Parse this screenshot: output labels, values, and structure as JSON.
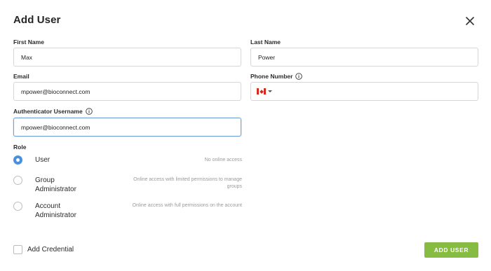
{
  "dialog": {
    "title": "Add User",
    "close_icon": "close-icon"
  },
  "form": {
    "first_name": {
      "label": "First Name",
      "value": "Max"
    },
    "last_name": {
      "label": "Last Name",
      "value": "Power"
    },
    "email": {
      "label": "Email",
      "value": "mpower@bioconnect.com"
    },
    "phone": {
      "label": "Phone Number",
      "info_icon": "info-icon",
      "country": "CA",
      "country_flag_icon": "canada-flag-icon",
      "value": ""
    },
    "auth_username": {
      "label": "Authenticator Username",
      "info_icon": "info-icon",
      "value": "mpower@bioconnect.com"
    }
  },
  "role": {
    "label": "Role",
    "selected": "User",
    "options": [
      {
        "title": "User",
        "description": "No online access",
        "checked": true
      },
      {
        "title": "Group Administrator",
        "title_lines": [
          "Group",
          "Administrator"
        ],
        "description_lines": [
          "Online access with limited permissions to manage",
          "groups"
        ],
        "checked": false
      },
      {
        "title": "Account Administrator",
        "title_lines": [
          "Account",
          "Administrator"
        ],
        "description": "Online access with full permissions on the account",
        "checked": false
      }
    ]
  },
  "add_credential": {
    "label": "Add Credential",
    "checked": false
  },
  "submit": {
    "label": "ADD USER"
  },
  "colors": {
    "accent_blue": "#4a90e2",
    "primary_green": "#86bc42",
    "focus_border": "#6fa3d8"
  }
}
